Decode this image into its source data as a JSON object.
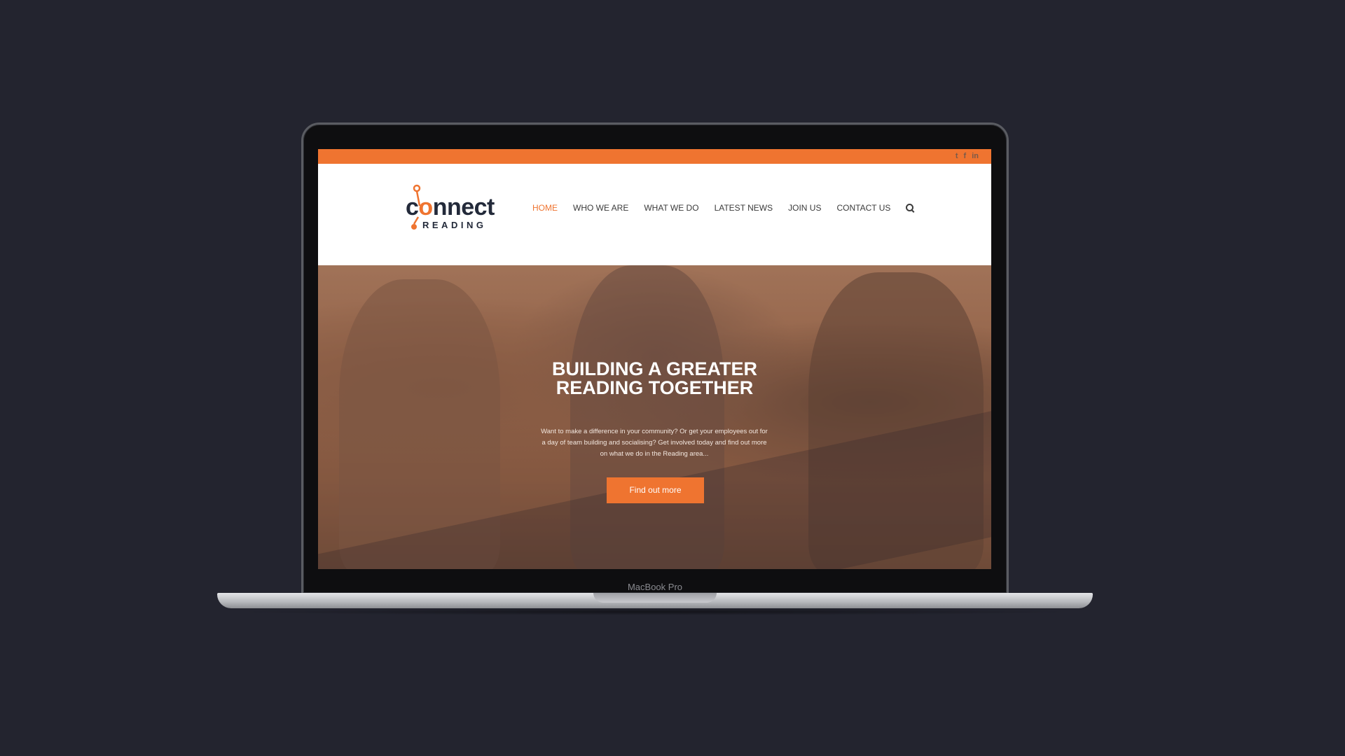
{
  "device": {
    "model_label": "MacBook Pro"
  },
  "site": {
    "topbar": {
      "social_icons": [
        "twitter-icon",
        "facebook-icon",
        "linkedin-icon"
      ],
      "accent_color": "#ef7430"
    },
    "logo": {
      "word": "connect",
      "sub": "READING"
    },
    "nav": {
      "items": [
        {
          "label": "HOME",
          "active": true
        },
        {
          "label": "WHO WE ARE",
          "active": false
        },
        {
          "label": "WHAT WE DO",
          "active": false
        },
        {
          "label": "LATEST NEWS",
          "active": false
        },
        {
          "label": "JOIN US",
          "active": false
        },
        {
          "label": "CONTACT US",
          "active": false
        }
      ],
      "search_icon": "search-icon"
    },
    "hero": {
      "title_line1": "BUILDING A GREATER",
      "title_line2": "READING TOGETHER",
      "text": "Want to make a difference in your community? Or get your employees out for a day of team building and socialising? Get involved today and find out more on what we do in the Reading area...",
      "button_label": "Find out more"
    }
  }
}
